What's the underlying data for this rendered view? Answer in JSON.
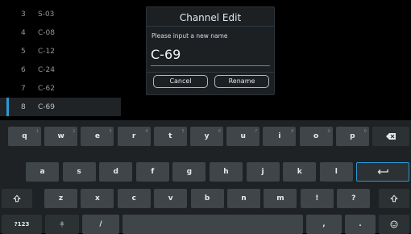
{
  "channels": [
    {
      "num": "3",
      "name": "S-03",
      "selected": false
    },
    {
      "num": "4",
      "name": "C-08",
      "selected": false
    },
    {
      "num": "5",
      "name": "C-12",
      "selected": false
    },
    {
      "num": "6",
      "name": "C-24",
      "selected": false
    },
    {
      "num": "7",
      "name": "C-62",
      "selected": false
    },
    {
      "num": "8",
      "name": "C-69",
      "selected": true
    }
  ],
  "dialog": {
    "title": "Channel Edit",
    "prompt": "Please input a new name",
    "input_value": "C-69",
    "cancel_label": "Cancel",
    "rename_label": "Rename"
  },
  "keyboard": {
    "row1": [
      {
        "label": "q",
        "hint": "1"
      },
      {
        "label": "w",
        "hint": "2"
      },
      {
        "label": "e",
        "hint": "3"
      },
      {
        "label": "r",
        "hint": "4"
      },
      {
        "label": "t",
        "hint": "5"
      },
      {
        "label": "y",
        "hint": "6"
      },
      {
        "label": "u",
        "hint": "7"
      },
      {
        "label": "i",
        "hint": "8"
      },
      {
        "label": "o",
        "hint": "9"
      },
      {
        "label": "p",
        "hint": "0"
      }
    ],
    "row2": [
      {
        "label": "a"
      },
      {
        "label": "s"
      },
      {
        "label": "d"
      },
      {
        "label": "f"
      },
      {
        "label": "g"
      },
      {
        "label": "h"
      },
      {
        "label": "j"
      },
      {
        "label": "k"
      },
      {
        "label": "l"
      }
    ],
    "row3": [
      {
        "label": "z"
      },
      {
        "label": "x"
      },
      {
        "label": "c"
      },
      {
        "label": "v"
      },
      {
        "label": "b"
      },
      {
        "label": "n"
      },
      {
        "label": "m"
      },
      {
        "label": "!"
      },
      {
        "label": "?"
      }
    ],
    "symbols_label": "?123",
    "slash_label": "/",
    "comma_label": ",",
    "period_label": ".",
    "icons": {
      "backspace": "backspace-icon",
      "enter": "enter-icon",
      "shift": "shift-icon",
      "mic": "microphone-icon",
      "emoji": "emoji-icon"
    },
    "accent_color": "#2a9ad6"
  }
}
